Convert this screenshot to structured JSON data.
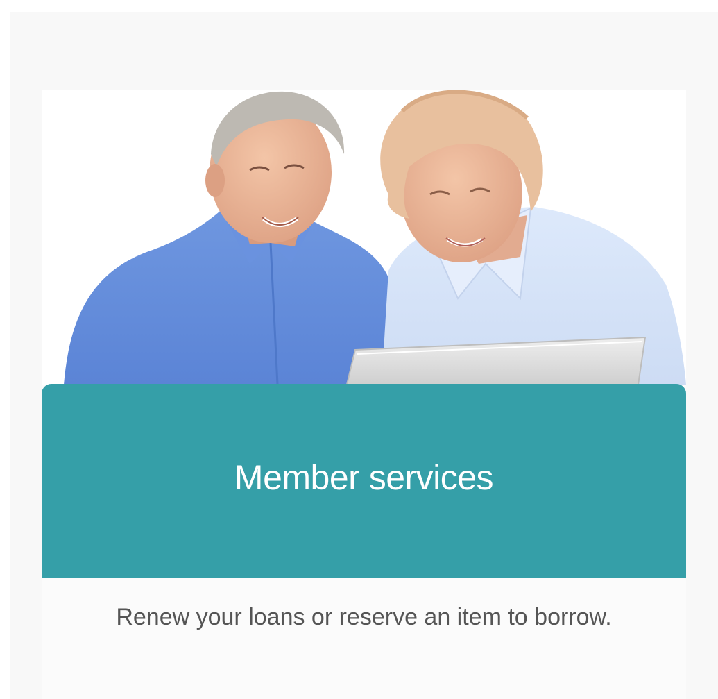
{
  "card": {
    "title": "Member services",
    "description": "Renew your loans or reserve an item to borrow.",
    "image": "photo-seniors-using-laptop"
  },
  "colors": {
    "accent": "#359fa8",
    "page_background": "#f8f8f8",
    "title_text": "#ffffff",
    "description_text": "#555555"
  }
}
